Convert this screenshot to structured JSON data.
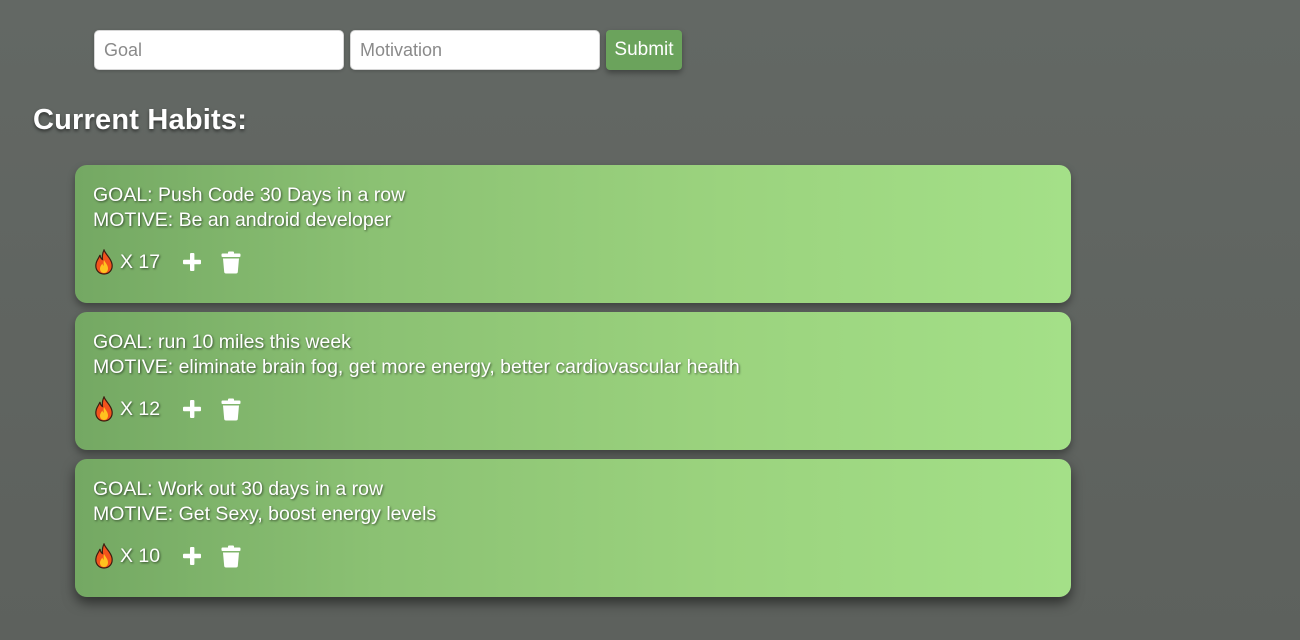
{
  "form": {
    "goal_placeholder": "Goal",
    "motivation_placeholder": "Motivation",
    "submit_label": "Submit"
  },
  "heading": "Current Habits:",
  "icons": {
    "streak": "fire-icon",
    "increment": "plus-icon",
    "delete": "trash-icon"
  },
  "colors": {
    "background": "#616662",
    "card_gradient_start": "#74a863",
    "card_gradient_end": "#a4e088",
    "submit_button": "#6ba35c",
    "text": "#ffffff"
  },
  "habits": [
    {
      "goal": "GOAL: Push Code 30 Days in a row",
      "motive": "MOTIVE: Be an android developer",
      "streak": "X 17"
    },
    {
      "goal": "GOAL: run 10 miles this week",
      "motive": "MOTIVE: eliminate brain fog, get more energy, better cardiovascular health",
      "streak": "X 12"
    },
    {
      "goal": "GOAL: Work out 30 days in a row",
      "motive": "MOTIVE: Get Sexy, boost energy levels",
      "streak": "X 10"
    }
  ]
}
